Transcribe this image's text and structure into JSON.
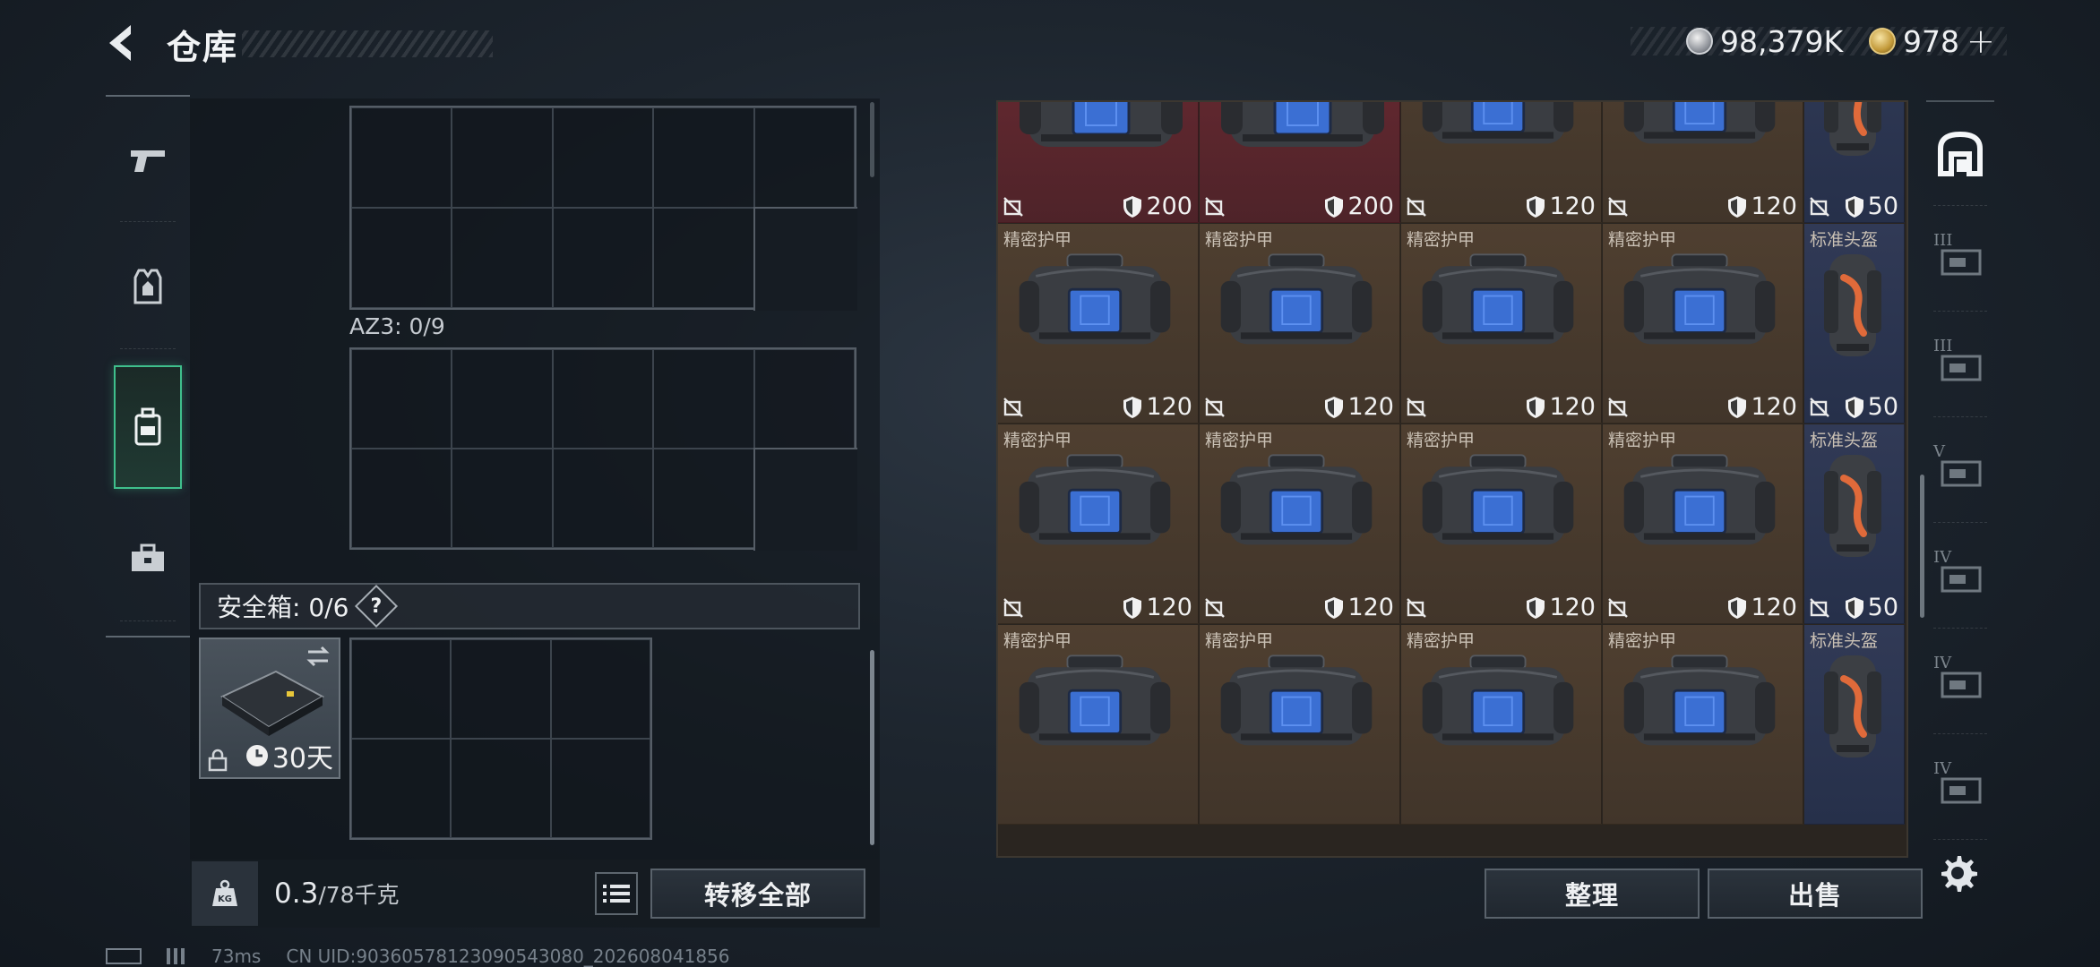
{
  "header": {
    "title": "仓库",
    "currency_1": "98,379K",
    "currency_2": "978",
    "add_symbol": "+"
  },
  "storage": {
    "container_label": "AZ3: 0/9",
    "safe_box_label": "安全箱: 0/6",
    "help_symbol": "?",
    "case_duration": "30天",
    "weight_value": "0.3",
    "weight_capacity": "/78千克",
    "transfer_all": "转移全部"
  },
  "items": [
    {
      "name": "",
      "value": "200",
      "rarity": "red",
      "kind": "bag-large"
    },
    {
      "name": "",
      "value": "200",
      "rarity": "red",
      "kind": "bag-large"
    },
    {
      "name": "",
      "value": "120",
      "rarity": "brown",
      "kind": "bag"
    },
    {
      "name": "",
      "value": "120",
      "rarity": "brown",
      "kind": "bag"
    },
    {
      "name": "",
      "value": "50",
      "rarity": "navy",
      "kind": "helmet"
    },
    {
      "name": "精密护甲",
      "value": "120",
      "rarity": "brown",
      "kind": "bag"
    },
    {
      "name": "精密护甲",
      "value": "120",
      "rarity": "brown",
      "kind": "bag"
    },
    {
      "name": "精密护甲",
      "value": "120",
      "rarity": "brown",
      "kind": "bag"
    },
    {
      "name": "精密护甲",
      "value": "120",
      "rarity": "brown",
      "kind": "bag"
    },
    {
      "name": "标准头盔",
      "value": "50",
      "rarity": "navy",
      "kind": "helmet"
    },
    {
      "name": "精密护甲",
      "value": "120",
      "rarity": "brown",
      "kind": "bag"
    },
    {
      "name": "精密护甲",
      "value": "120",
      "rarity": "brown",
      "kind": "bag"
    },
    {
      "name": "精密护甲",
      "value": "120",
      "rarity": "brown",
      "kind": "bag"
    },
    {
      "name": "精密护甲",
      "value": "120",
      "rarity": "brown",
      "kind": "bag"
    },
    {
      "name": "标准头盔",
      "value": "50",
      "rarity": "navy",
      "kind": "helmet"
    },
    {
      "name": "精密护甲",
      "value": "",
      "rarity": "brown",
      "kind": "bag"
    },
    {
      "name": "精密护甲",
      "value": "",
      "rarity": "brown",
      "kind": "bag"
    },
    {
      "name": "精密护甲",
      "value": "",
      "rarity": "brown",
      "kind": "bag"
    },
    {
      "name": "精密护甲",
      "value": "",
      "rarity": "brown",
      "kind": "bag"
    },
    {
      "name": "标准头盔",
      "value": "",
      "rarity": "navy",
      "kind": "helmet"
    }
  ],
  "actions": {
    "sort": "整理",
    "sell": "出售"
  },
  "right_tabs": [
    {
      "icon": "armor-tab-icon",
      "label": ""
    },
    {
      "icon": "tier-3-weapon-icon",
      "label": "III"
    },
    {
      "icon": "tier-3-armor-icon",
      "label": "III"
    },
    {
      "icon": "tier-5-gear-icon",
      "label": "V"
    },
    {
      "icon": "tier-4-weapon-icon",
      "label": "IV"
    },
    {
      "icon": "tier-4-medkit-icon",
      "label": "IV"
    },
    {
      "icon": "tier-4-folder-icon",
      "label": "IV"
    }
  ],
  "footer": {
    "ping": "73ms",
    "uid": "CN UID:90360578123090543080_202608041856"
  },
  "colors": {
    "accent_green": "#3fbf8c",
    "rarity_red": "#6b2a32",
    "rarity_brown": "#4f3f30",
    "rarity_navy": "#313a56"
  }
}
